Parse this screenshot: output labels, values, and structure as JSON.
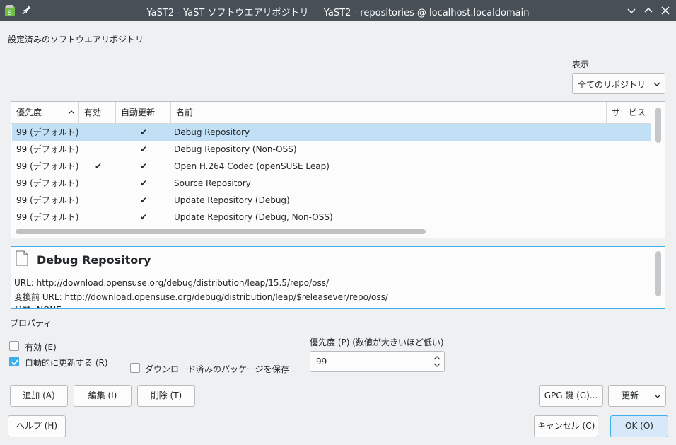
{
  "window": {
    "title": "YaST2 - YaST ソフトウエアリポジトリ — YaST2 - repositories @ localhost.localdomain"
  },
  "page": {
    "heading": "設定済みのソフトウエアリポジトリ",
    "view_label": "表示",
    "view_value": "全てのリポジトリ"
  },
  "table": {
    "columns": [
      "優先度",
      "有効",
      "自動更新",
      "名前",
      "サービス"
    ],
    "rows": [
      {
        "priority": "99 (デフォルト)",
        "enabled": "",
        "autorefresh": "✔",
        "name": "Debug Repository",
        "service": "",
        "selected": true
      },
      {
        "priority": "99 (デフォルト)",
        "enabled": "",
        "autorefresh": "✔",
        "name": "Debug Repository (Non-OSS)",
        "service": ""
      },
      {
        "priority": "99 (デフォルト)",
        "enabled": "✔",
        "autorefresh": "✔",
        "name": "Open H.264 Codec (openSUSE Leap)",
        "service": ""
      },
      {
        "priority": "99 (デフォルト)",
        "enabled": "",
        "autorefresh": "✔",
        "name": "Source Repository",
        "service": ""
      },
      {
        "priority": "99 (デフォルト)",
        "enabled": "",
        "autorefresh": "✔",
        "name": "Update Repository (Debug)",
        "service": ""
      },
      {
        "priority": "99 (デフォルト)",
        "enabled": "",
        "autorefresh": "✔",
        "name": "Update Repository (Debug, Non-OSS)",
        "service": ""
      }
    ]
  },
  "info": {
    "title": "Debug Repository",
    "url_line": "URL: http://download.opensuse.org/debug/distribution/leap/15.5/repo/oss/",
    "raw_url_line": "変換前 URL: http://download.opensuse.org/debug/distribution/leap/$releasever/repo/oss/",
    "category_line": "分類: NONE"
  },
  "properties": {
    "label": "プロパティ",
    "enabled_label": "有効 (E)",
    "enabled_checked": false,
    "autorefresh_label": "自動的に更新する (R)",
    "autorefresh_checked": true,
    "keep_packages_label": "ダウンロード済みのパッケージを保存",
    "keep_packages_checked": false,
    "priority_label": "優先度 (P) (数値が大きいほど低い)",
    "priority_value": "99"
  },
  "buttons": {
    "add": "追加 (A)",
    "edit": "編集 (I)",
    "delete": "削除 (T)",
    "gpg": "GPG 鍵 (G)...",
    "refresh": "更新",
    "help": "ヘルプ (H)",
    "cancel": "キャンセル (C)",
    "ok": "OK (O)"
  },
  "colors": {
    "accent": "#3daee9",
    "selection": "#c2e0f5",
    "titlebar": "#475057"
  }
}
